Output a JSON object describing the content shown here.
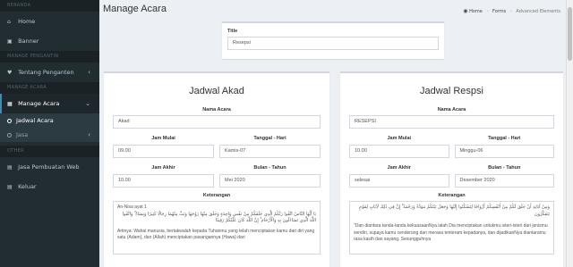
{
  "sidebar": {
    "header_main": "BERANDA",
    "home": "Home",
    "banner": "Banner",
    "header_pengantin": "MANAGE PENGANTIN",
    "tentang_pengantin": "Tentang Penganten",
    "header_acara": "MANAGE ACARA",
    "manage_acara": "Manage Acara",
    "jadwal_acara": "Jadwal Acara",
    "jasa": "Jasa",
    "header_other": "OTHER",
    "jasa_web": "Jasa Pembuatan Web",
    "keluar": "Keluar"
  },
  "header": {
    "page_title": "Manage Acara",
    "breadcrumb_home": "Home",
    "breadcrumb_forms": "Forms",
    "breadcrumb_current": "Advanced Elements"
  },
  "title_box": {
    "label": "Title",
    "value": "Resepsi"
  },
  "akad": {
    "heading": "Jadwal Akad",
    "nama_acara_label": "Nama Acara",
    "nama_acara": "Akad",
    "jam_mulai_label": "Jam Mulai",
    "jam_mulai": "09.00",
    "tanggal_label": "Tanggal - Hari",
    "tanggal": "Kamis-07",
    "jam_akhir_label": "Jam Akhir",
    "jam_akhir": "10.00",
    "bulan_label": "Bulan - Tahun",
    "bulan": "Mei 2020",
    "keterangan_label": "Keterangan",
    "ket_ref": "An-Nisa ayat 1",
    "ket_arabic": "يَا أَيُّهَا النَّاسُ اتَّقُوا رَبَّكُمُ الَّذِي خَلَقَكُمْ مِنْ نَفْسٍ وَاحِدَةٍ وَخَلَقَ مِنْهَا زَوْجَهَا وَبَثَّ مِنْهُمَا رِجَالًا كَثِيرًا وَنِسَاءً ۚ وَاتَّقُوا اللَّهَ الَّذِي تَسَاءَلُونَ بِهِ وَالْأَرْحَامَ ۚ إِنَّ اللَّهَ كَانَ عَلَيْكُمْ رَقِيبًا",
    "ket_text": "Artinya: Wahai manusia, bertakwalah kepada Tuhanmu yang telah menciptakan kamu dari diri yang satu (Adam), dan (Allah) menciptakan pasangannya (Hawa) dari"
  },
  "resepsi": {
    "heading": "Jadwal Respsi",
    "nama_acara_label": "Nama Acara",
    "nama_acara": "RESEPSI",
    "jam_mulai_label": "Jam Mulai",
    "jam_mulai": "10.00",
    "tanggal_label": "Tanggal - Hari",
    "tanggal": "Minggu-06",
    "jam_akhir_label": "Jam Akhir",
    "jam_akhir": "selesai",
    "bulan_label": "Bulan - Tahun",
    "bulan": "Desember 2020",
    "keterangan_label": "Keterangan",
    "ket_arabic": "وَمِنْ آيَاتِهِ أَنْ خَلَقَ لَكُمْ مِنْ أَنْفُسِكُمْ أَزْوَاجًا لِتَسْكُنُوا إِلَيْهَا وَجَعَلَ بَيْنَكُمْ مَوَدَّةً وَرَحْمَةً ۚ إِنَّ فِي ذَٰلِكَ لَآيَاتٍ لِقَوْمٍ يَتَفَكَّرُونَ",
    "ket_text": "\"Dan diantara tanda-tanda kekuasaanNya ialah Dia menciptakan untukmu isteri-isteri dari jenismu sendiri, supaya kamu cenderung dan merasa tenteram kepadanya, dan dijadikanNya diantaramu rasa kasih dan sayang. Sesungguhnya"
  }
}
